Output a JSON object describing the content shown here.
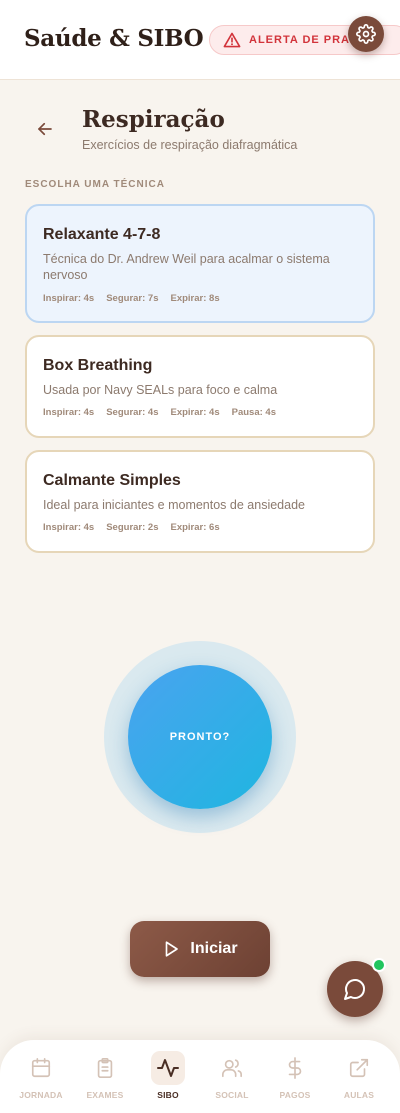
{
  "header": {
    "brand": "Saúde & SIBO",
    "alert_label": "ALERTA DE PRAZO"
  },
  "page": {
    "title": "Respiração",
    "subtitle": "Exercícios de respiração diafragmática",
    "section_label": "ESCOLHA UMA TÉCNICA"
  },
  "techniques": [
    {
      "name": "Relaxante 4-7-8",
      "description": "Técnica do Dr. Andrew Weil para acalmar o sistema nervoso",
      "stats": [
        "Inspirar: 4s",
        "Segurar: 7s",
        "Expirar: 8s"
      ],
      "selected": true
    },
    {
      "name": "Box Breathing",
      "description": "Usada por Navy SEALs para foco e calma",
      "stats": [
        "Inspirar: 4s",
        "Segurar: 4s",
        "Expirar: 4s",
        "Pausa: 4s"
      ],
      "selected": false
    },
    {
      "name": "Calmante Simples",
      "description": "Ideal para iniciantes e momentos de ansiedade",
      "stats": [
        "Inspirar: 4s",
        "Segurar: 2s",
        "Expirar: 6s"
      ],
      "selected": false
    }
  ],
  "breathing": {
    "state_label": "PRONTO?"
  },
  "actions": {
    "start_label": "Iniciar"
  },
  "nav": {
    "active": "SIBO",
    "items": [
      {
        "label": "JORNADA",
        "icon": "calendar-icon"
      },
      {
        "label": "EXAMES",
        "icon": "clipboard-icon"
      },
      {
        "label": "SIBO",
        "icon": "activity-icon"
      },
      {
        "label": "SOCIAL",
        "icon": "users-icon"
      },
      {
        "label": "PAGOS",
        "icon": "dollar-icon"
      },
      {
        "label": "AULAS",
        "icon": "external-link-icon"
      }
    ]
  },
  "colors": {
    "accent": "#7a4a3a",
    "alert": "#d2343b",
    "orb_start": "#4aa3f0",
    "orb_end": "#1fb6e0",
    "online": "#22c55e"
  }
}
